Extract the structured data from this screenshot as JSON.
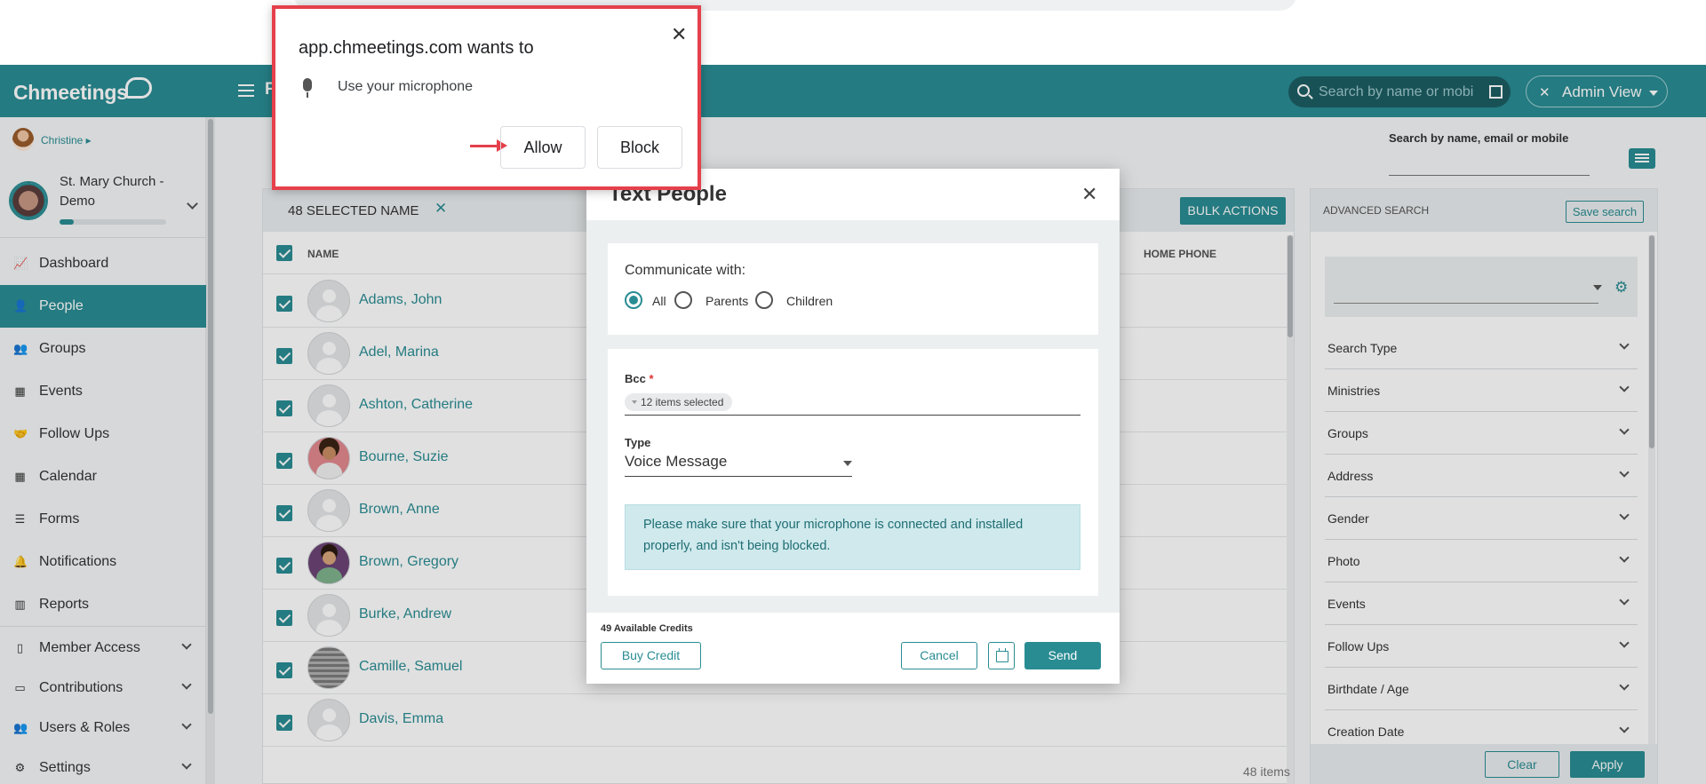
{
  "header": {
    "logo": "Chmeetings",
    "peek_letter": "F",
    "search_placeholder": "Search by name or mobi",
    "admin_view_label": "Admin View"
  },
  "sidebar": {
    "user_name": "Christine ▸",
    "church_name": "St. Mary Church - Demo",
    "church_progress": 0.13,
    "items": [
      {
        "label": "Dashboard",
        "icon": "chart-icon",
        "glyph": "📈",
        "chevron": false,
        "active": false
      },
      {
        "label": "People",
        "icon": "person-icon",
        "glyph": "👤",
        "chevron": false,
        "active": true
      },
      {
        "label": "Groups",
        "icon": "groups-icon",
        "glyph": "👥",
        "chevron": false,
        "active": false
      },
      {
        "label": "Events",
        "icon": "calendar-event-icon",
        "glyph": "▦",
        "chevron": false,
        "active": false
      },
      {
        "label": "Follow Ups",
        "icon": "handshake-icon",
        "glyph": "🤝",
        "chevron": false,
        "active": false
      },
      {
        "label": "Calendar",
        "icon": "calendar-icon",
        "glyph": "▦",
        "chevron": false,
        "active": false
      },
      {
        "label": "Forms",
        "icon": "list-icon",
        "glyph": "☰",
        "chevron": false,
        "active": false
      },
      {
        "label": "Notifications",
        "icon": "bell-icon",
        "glyph": "🔔",
        "chevron": false,
        "active": false
      },
      {
        "label": "Reports",
        "icon": "bar-chart-icon",
        "glyph": "▥",
        "chevron": false,
        "active": false
      },
      {
        "label": "Member Access",
        "icon": "mobile-icon",
        "glyph": "▯",
        "chevron": true,
        "active": false
      },
      {
        "label": "Contributions",
        "icon": "money-icon",
        "glyph": "▭",
        "chevron": true,
        "active": false
      },
      {
        "label": "Users & Roles",
        "icon": "users-icon",
        "glyph": "👥",
        "chevron": true,
        "active": false
      },
      {
        "label": "Settings",
        "icon": "gear-icon",
        "glyph": "⚙",
        "chevron": true,
        "active": false
      }
    ]
  },
  "right_search": {
    "label": "Search by name, email or mobile"
  },
  "people_table": {
    "selected_label": "48 SELECTED NAME",
    "clear_symbol": "✕",
    "bulk_actions_label": "BULK ACTIONS",
    "columns": {
      "name": "NAME",
      "home_phone": "HOME PHONE"
    },
    "rows": [
      {
        "name": "Adams, John",
        "photo": "default"
      },
      {
        "name": "Adel, Marina",
        "photo": "default"
      },
      {
        "name": "Ashton, Catherine",
        "photo": "default"
      },
      {
        "name": "Bourne, Suzie",
        "photo": "female"
      },
      {
        "name": "Brown, Anne",
        "photo": "default"
      },
      {
        "name": "Brown, Gregory",
        "photo": "male"
      },
      {
        "name": "Burke, Andrew",
        "photo": "default"
      },
      {
        "name": "Camille, Samuel",
        "photo": "qr"
      },
      {
        "name": "Davis, Emma",
        "photo": "default"
      }
    ],
    "items_count": "48 items"
  },
  "advanced_search": {
    "title": "ADVANCED SEARCH",
    "save_label": "Save search",
    "filters": [
      "Search Type",
      "Ministries",
      "Groups",
      "Address",
      "Gender",
      "Photo",
      "Events",
      "Follow Ups",
      "Birthdate / Age",
      "Creation Date"
    ],
    "clear_label": "Clear",
    "apply_label": "Apply"
  },
  "modal": {
    "title": "Text People",
    "communicate_label": "Communicate with:",
    "options": [
      "All",
      "Parents",
      "Children"
    ],
    "selected_option": "All",
    "bcc_label": "Bcc",
    "bcc_required": "*",
    "bcc_chip": "12 items selected",
    "type_label": "Type",
    "type_value": "Voice Message",
    "mic_note": "Please make sure that your microphone is connected and installed properly, and isn't being blocked.",
    "credits": "49 Available Credits",
    "buy_credit_label": "Buy Credit",
    "cancel_label": "Cancel",
    "send_label": "Send"
  },
  "permission_popup": {
    "title": "app.chmeetings.com wants to",
    "description": "Use your microphone",
    "allow_label": "Allow",
    "block_label": "Block",
    "highlight_color": "#e5404b"
  },
  "colors": {
    "brand": "#2a8c93",
    "brand_dark": "#1c5e63"
  }
}
